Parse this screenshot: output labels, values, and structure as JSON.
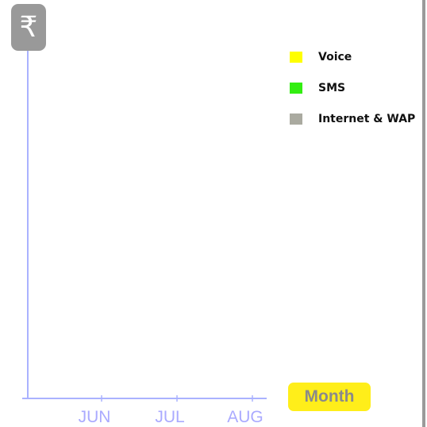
{
  "y_axis_badge": {
    "symbol": "₹"
  },
  "x_axis_badge": {
    "label": "Month"
  },
  "colors": {
    "axis": "#aab2ff",
    "tick_label": "#aaaaff",
    "badge_gray": "#999999",
    "badge_yellow": "#ffee1a"
  },
  "chart_data": {
    "type": "bar",
    "categories": [
      "JUN",
      "JUL",
      "AUG"
    ],
    "series": [
      {
        "name": "Voice",
        "color": "#ffff00",
        "values": []
      },
      {
        "name": "SMS",
        "color": "#33ee11",
        "values": []
      },
      {
        "name": "Internet & WAP",
        "color": "#aaaaa0",
        "values": []
      }
    ],
    "legend": "top-right",
    "grid": false
  }
}
